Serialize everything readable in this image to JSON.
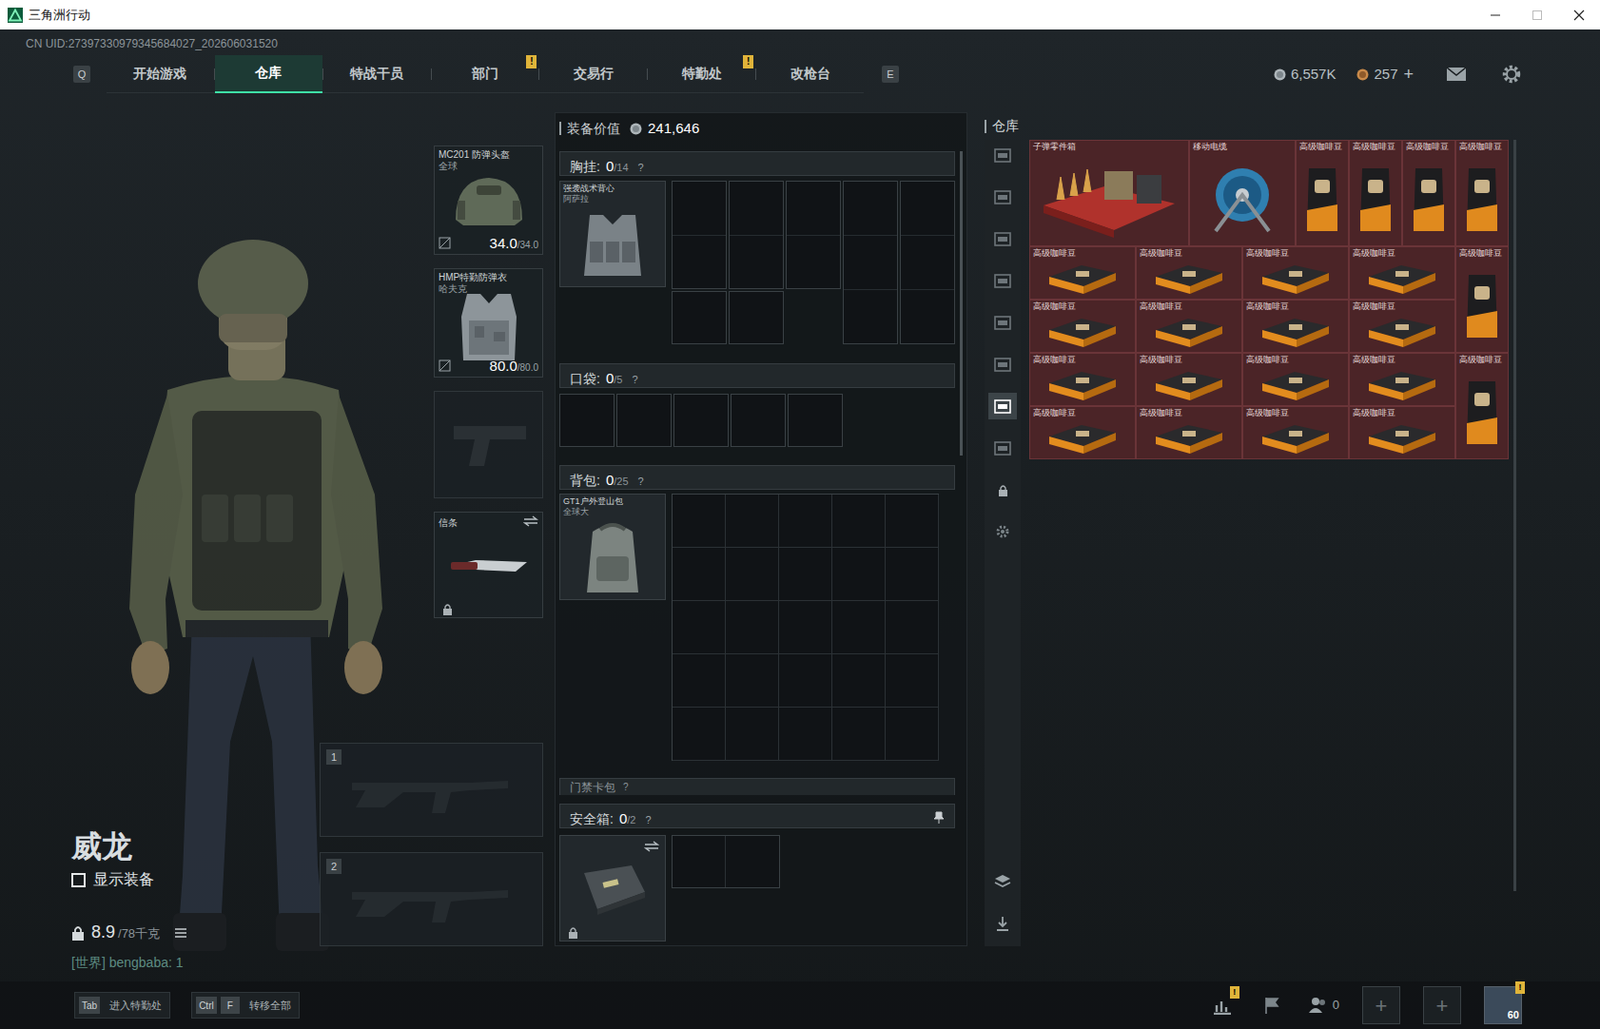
{
  "window": {
    "title": "三角洲行动",
    "uid": "CN UID:27397330979345684027_202606031520"
  },
  "nav": {
    "prev_key": "Q",
    "next_key": "E",
    "tabs": [
      {
        "label": "开始游戏",
        "selected": false,
        "badge": null
      },
      {
        "label": "仓库",
        "selected": true,
        "badge": null
      },
      {
        "label": "特战干员",
        "selected": false,
        "badge": null
      },
      {
        "label": "部门",
        "selected": false,
        "badge": "!"
      },
      {
        "label": "交易行",
        "selected": false,
        "badge": null
      },
      {
        "label": "特勤处",
        "selected": false,
        "badge": "!"
      },
      {
        "label": "改枪台",
        "selected": false,
        "badge": null
      }
    ]
  },
  "currency": {
    "coins": "6,557K",
    "tickets": "257",
    "add": "+"
  },
  "operator": {
    "name": "威龙",
    "show_equipment": {
      "label": "显示装备",
      "checked": false
    },
    "weight": "8.9",
    "weight_max": "/78千克",
    "chat": "[世界] bengbaba: 1"
  },
  "equipment": {
    "helmet": {
      "name": "MC201 防弹头盔",
      "origin": "全球",
      "durability": "34.0",
      "max": "/34.0"
    },
    "armor": {
      "name": "HMP特勤防弹衣",
      "origin": "哈夫克",
      "durability": "80.0",
      "max": "/80.0"
    },
    "melee": {
      "name": "信条",
      "locked": true
    },
    "weapons": [
      {
        "slot": "1"
      },
      {
        "slot": "2"
      }
    ]
  },
  "loadout": {
    "value_label": "装备价值",
    "value": "241,646",
    "chest": {
      "label": "胸挂:",
      "count": "0",
      "capacity": "/14",
      "help": "?",
      "item": {
        "name": "强袭战术背心",
        "origin": "阿萨拉"
      }
    },
    "pockets": {
      "label": "口袋:",
      "count": "0",
      "capacity": "/5",
      "help": "?"
    },
    "backpack": {
      "label": "背包:",
      "count": "0",
      "capacity": "/25",
      "help": "?",
      "item": {
        "name": "GT1户外登山包",
        "origin": "全球大"
      }
    },
    "keycase": {
      "label": "门禁卡包",
      "help": "?"
    },
    "safe": {
      "label": "安全箱:",
      "count": "0",
      "capacity": "/2",
      "help": "?",
      "locked": true
    }
  },
  "warehouse": {
    "title": "仓库",
    "tabs": [
      {
        "selected": false
      },
      {
        "selected": false
      },
      {
        "selected": false
      },
      {
        "selected": false
      },
      {
        "selected": false
      },
      {
        "selected": false
      },
      {
        "selected": true
      },
      {
        "selected": false
      }
    ],
    "items": [
      {
        "name": "子弹零件箱",
        "kind": "case"
      },
      {
        "name": "移动电缆",
        "kind": "reel"
      },
      {
        "name": "高级咖啡豆",
        "kind": "bag"
      },
      {
        "name": "高级咖啡豆",
        "kind": "bag"
      },
      {
        "name": "高级咖啡豆",
        "kind": "bag"
      },
      {
        "name": "高级咖啡豆",
        "kind": "bag"
      },
      {
        "name": "高级咖啡豆",
        "kind": "brick"
      },
      {
        "name": "高级咖啡豆",
        "kind": "brick"
      },
      {
        "name": "高级咖啡豆",
        "kind": "brick"
      },
      {
        "name": "高级咖啡豆",
        "kind": "brick"
      },
      {
        "name": "高级咖啡豆",
        "kind": "bag"
      },
      {
        "name": "高级咖啡豆",
        "kind": "brick"
      },
      {
        "name": "高级咖啡豆",
        "kind": "brick"
      },
      {
        "name": "高级咖啡豆",
        "kind": "brick"
      },
      {
        "name": "高级咖啡豆",
        "kind": "brick"
      },
      {
        "name": "高级咖啡豆",
        "kind": "brick"
      },
      {
        "name": "高级咖啡豆",
        "kind": "brick"
      },
      {
        "name": "高级咖啡豆",
        "kind": "brick"
      },
      {
        "name": "高级咖啡豆",
        "kind": "brick"
      },
      {
        "name": "高级咖啡豆",
        "kind": "bag"
      },
      {
        "name": "高级咖啡豆",
        "kind": "brick"
      },
      {
        "name": "高级咖啡豆",
        "kind": "brick"
      },
      {
        "name": "高级咖啡豆",
        "kind": "brick"
      },
      {
        "name": "高级咖啡豆",
        "kind": "brick"
      }
    ]
  },
  "bottom": {
    "hints": [
      {
        "keys": [
          "Tab"
        ],
        "label": "进入特勤处"
      },
      {
        "keys": [
          "Ctrl",
          "F"
        ],
        "label": "转移全部"
      }
    ],
    "stats_badge": "!",
    "friends": "0",
    "slots": [
      "+",
      "+"
    ],
    "level": "60",
    "avatar_badge": "!"
  }
}
